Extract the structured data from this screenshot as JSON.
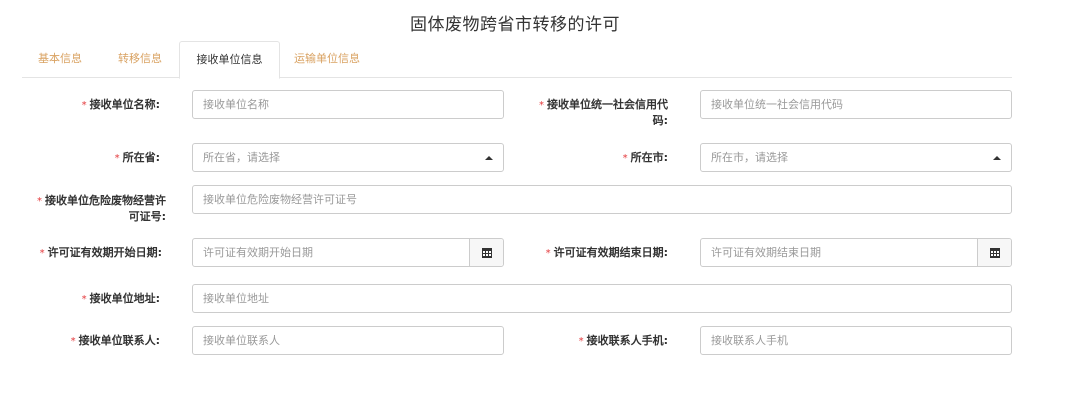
{
  "page": {
    "title": "固体废物跨省市转移的许可"
  },
  "tabs": [
    {
      "label": "基本信息",
      "active": false
    },
    {
      "label": "转移信息",
      "active": false
    },
    {
      "label": "接收单位信息",
      "active": true
    },
    {
      "label": "运输单位信息",
      "active": false
    }
  ],
  "form": {
    "required_mark": "*",
    "unit_name": {
      "label": "接收单位名称:",
      "placeholder": "接收单位名称",
      "value": ""
    },
    "credit_code": {
      "label_line1": "接收单位统一社会信用代",
      "label_line2": "码:",
      "placeholder": "接收单位统一社会信用代码",
      "value": ""
    },
    "province": {
      "label": "所在省:",
      "placeholder": "所在省，请选择",
      "value": ""
    },
    "city": {
      "label": "所在市:",
      "placeholder": "所在市，请选择",
      "value": ""
    },
    "license_no": {
      "label_line1": "接收单位危险废物经营许",
      "label_line2": "可证号:",
      "placeholder": "接收单位危险废物经营许可证号",
      "value": ""
    },
    "start_date": {
      "label": "许可证有效期开始日期:",
      "placeholder": "许可证有效期开始日期",
      "value": ""
    },
    "end_date": {
      "label": "许可证有效期结束日期:",
      "placeholder": "许可证有效期结束日期",
      "value": ""
    },
    "address": {
      "label": "接收单位地址:",
      "placeholder": "接收单位地址",
      "value": ""
    },
    "contact": {
      "label": "接收单位联系人:",
      "placeholder": "接收单位联系人",
      "value": ""
    },
    "phone": {
      "label": "接收联系人手机:",
      "placeholder": "接收联系人手机",
      "value": ""
    }
  },
  "icons": {
    "calendar": "calendar-icon",
    "dropdown": "caret-up-icon"
  },
  "colors": {
    "required": "#e4393c",
    "tab_inactive": "#d9a262",
    "border": "#cccccc"
  }
}
